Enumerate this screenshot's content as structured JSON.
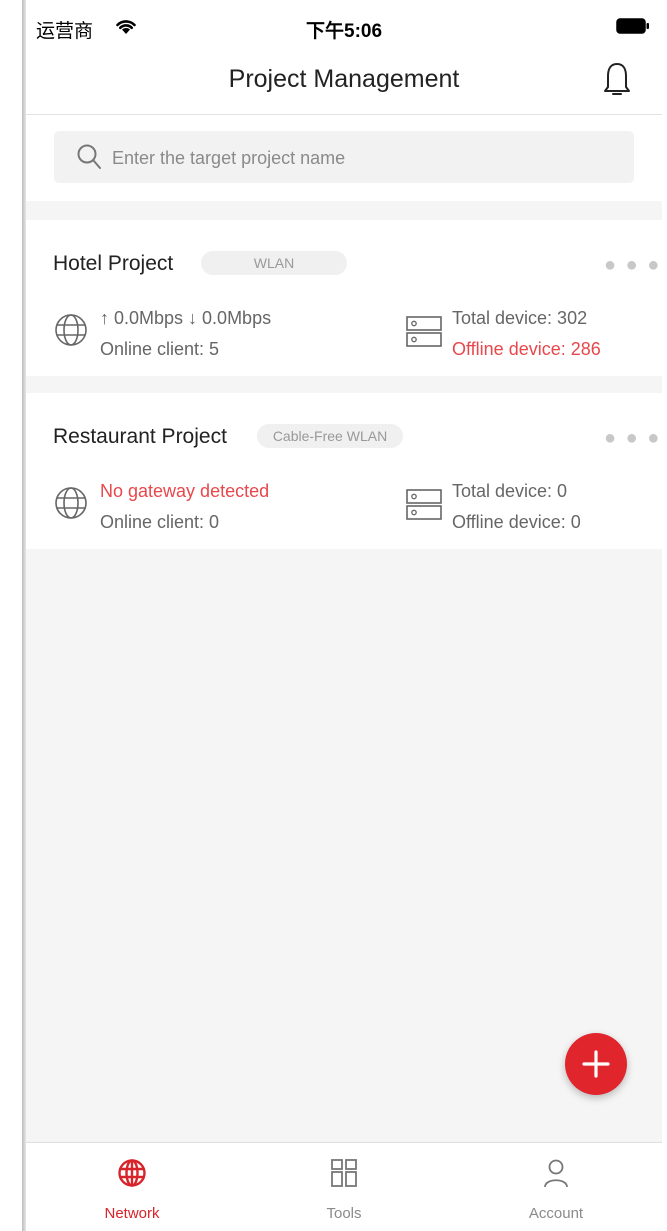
{
  "status_bar": {
    "carrier": "运营商",
    "time": "下午5:06"
  },
  "header": {
    "title": "Project Management"
  },
  "search": {
    "placeholder": "Enter the target project name",
    "value": ""
  },
  "projects": [
    {
      "name": "Hotel Project",
      "tag": "WLAN",
      "traffic": "↑ 0.0Mbps  ↓ 0.0Mbps",
      "online_client": "Online client: 5",
      "total_device": "Total device: 302",
      "offline_device": "Offline device: 286"
    },
    {
      "name": "Restaurant Project",
      "tag": "Cable-Free WLAN",
      "traffic": "No gateway detected",
      "online_client": "Online client: 0",
      "total_device": "Total device: 0",
      "offline_device": "Offline device: 0"
    }
  ],
  "tabs": [
    {
      "label": "Network",
      "icon": "network-globe-icon",
      "active": true
    },
    {
      "label": "Tools",
      "icon": "tools-grid-icon",
      "active": false
    },
    {
      "label": "Account",
      "icon": "account-person-icon",
      "active": false
    }
  ],
  "colors": {
    "accent": "#e0252c",
    "alert_text": "#e8474b",
    "background": "#f5f5f5"
  }
}
